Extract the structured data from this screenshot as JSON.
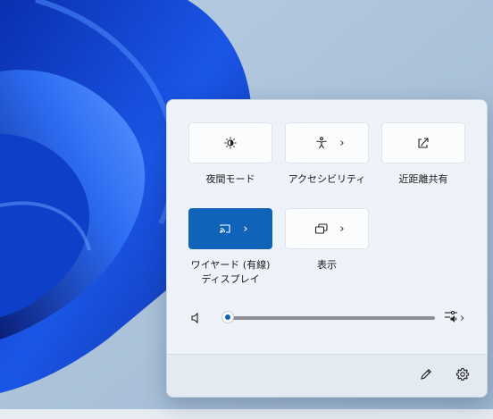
{
  "colors": {
    "accent": "#0f63b9",
    "panel_background": "#eef3f9",
    "tile_background": "#fbfcfe"
  },
  "quick_settings": {
    "tiles": [
      {
        "label": "夜間モード",
        "icon": "night-light-icon",
        "active": false,
        "has_chevron": false
      },
      {
        "label": "アクセシビリティ",
        "icon": "accessibility-icon",
        "active": false,
        "has_chevron": true
      },
      {
        "label": "近距離共有",
        "icon": "nearby-share-icon",
        "active": false,
        "has_chevron": false
      },
      {
        "label": "ワイヤード (有線)\nディスプレイ",
        "icon": "cast-icon",
        "active": true,
        "has_chevron": true
      },
      {
        "label": "表示",
        "icon": "project-icon",
        "active": false,
        "has_chevron": true
      }
    ],
    "volume": {
      "level_percent": 0,
      "icon": "speaker-icon",
      "output_icon": "audio-output-icon"
    },
    "footer": {
      "edit_icon": "pencil-icon",
      "settings_icon": "gear-icon"
    }
  }
}
